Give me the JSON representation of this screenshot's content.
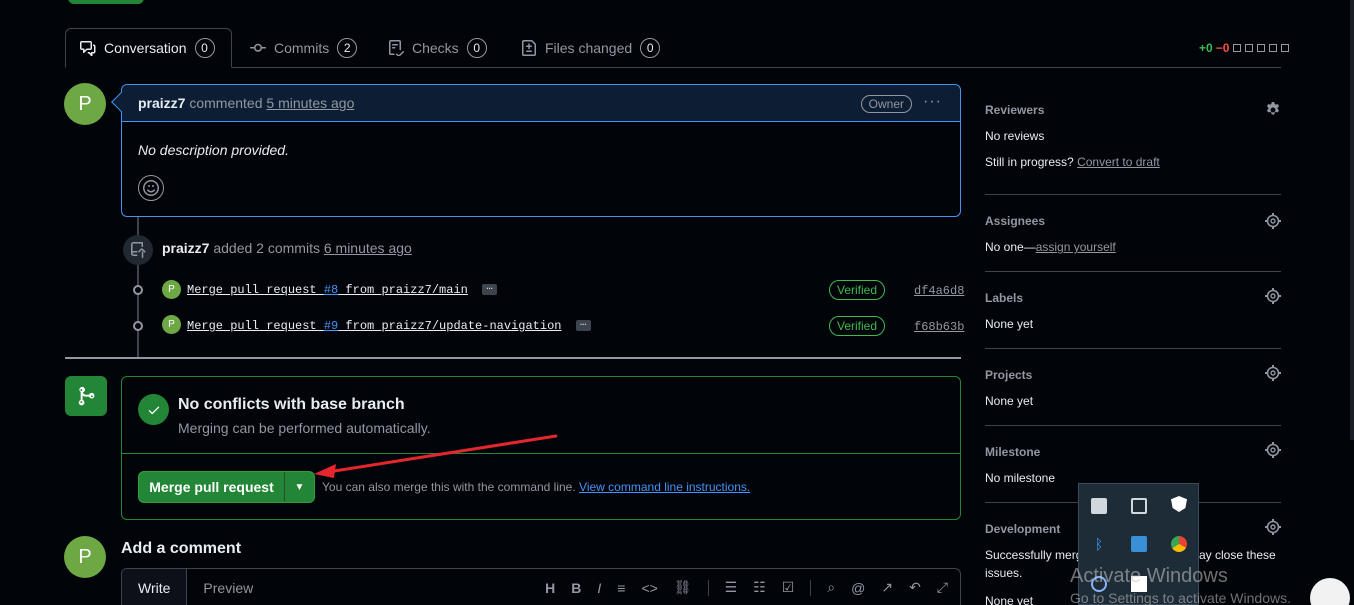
{
  "tabs": [
    {
      "label": "Conversation",
      "count": "0"
    },
    {
      "label": "Commits",
      "count": "2"
    },
    {
      "label": "Checks",
      "count": "0"
    },
    {
      "label": "Files changed",
      "count": "0"
    }
  ],
  "diffstat": {
    "additions": "+0",
    "deletions": "−0"
  },
  "comment": {
    "avatar_letter": "P",
    "author": "praizz7",
    "action": "commented",
    "time": "5 minutes ago",
    "badge": "Owner",
    "more": "···",
    "body": "No description provided."
  },
  "commits_event": {
    "author": "praizz7",
    "action": "added 2 commits",
    "time": "6 minutes ago",
    "commits": [
      {
        "avatar_letter": "P",
        "prefix": "Merge pull request ",
        "pr": "#8",
        "suffix": " from praizz7/main",
        "ellipsis": "…",
        "badge": "Verified",
        "sha": "df4a6d8"
      },
      {
        "avatar_letter": "P",
        "prefix": "Merge pull request ",
        "pr": "#9",
        "suffix": " from praizz7/update-navigation",
        "ellipsis": "…",
        "badge": "Verified",
        "sha": "f68b63b"
      }
    ]
  },
  "merge": {
    "title": "No conflicts with base branch",
    "subtitle": "Merging can be performed automatically.",
    "button": "Merge pull request",
    "note": "You can also merge this with the command line.",
    "note_link": "View command line instructions."
  },
  "add_comment": {
    "avatar_letter": "P",
    "title": "Add a comment",
    "tab_write": "Write",
    "tab_preview": "Preview"
  },
  "sidebar": {
    "reviewers": {
      "title": "Reviewers",
      "line1": "No reviews",
      "line2_prefix": "Still in progress?",
      "line2_link": "Convert to draft"
    },
    "assignees": {
      "title": "Assignees",
      "prefix": "No one—",
      "link": "assign yourself"
    },
    "labels": {
      "title": "Labels",
      "value": "None yet"
    },
    "projects": {
      "title": "Projects",
      "value": "None yet"
    },
    "milestone": {
      "title": "Milestone",
      "value": "No milestone"
    },
    "development": {
      "title": "Development",
      "line1a": "Successfully merg",
      "line1b": "ay close these",
      "line2": "issues.",
      "line3": "None yet"
    }
  },
  "watermark": {
    "line1": "Activate Windows",
    "line2": "Go to Settings to activate Windows."
  },
  "colors": {
    "accent_green": "#238636",
    "blue": "#4493f8",
    "annotation_arrow": "#e5262f"
  }
}
